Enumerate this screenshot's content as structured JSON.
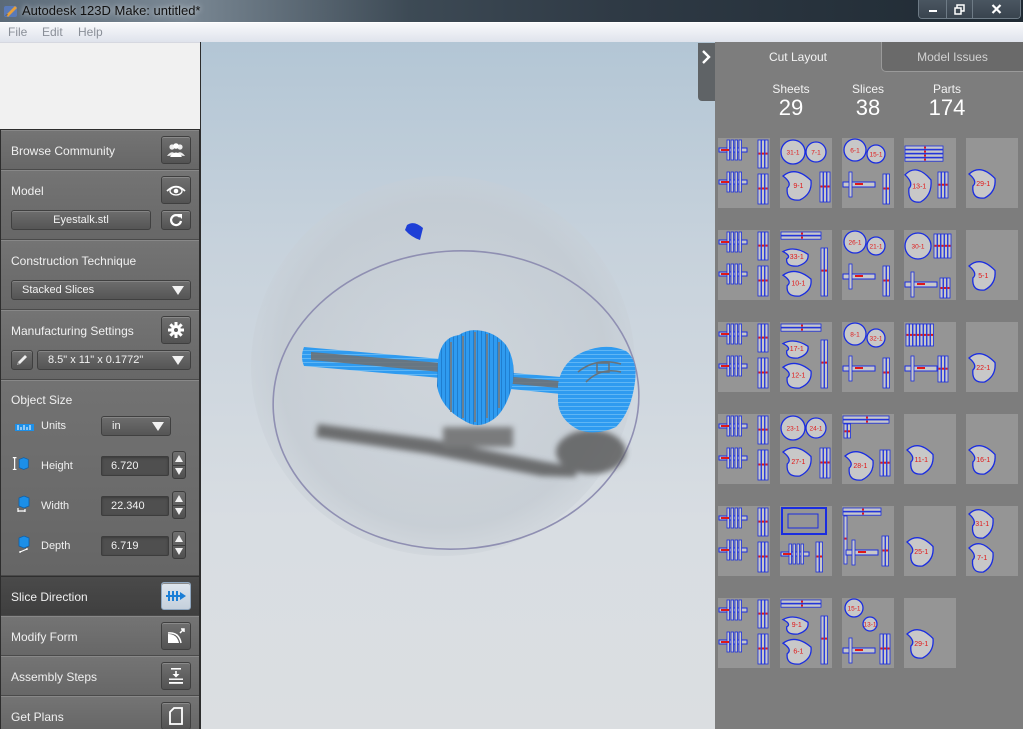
{
  "window": {
    "title": "Autodesk 123D Make: untitled*",
    "controls": {
      "minimize": "minimize",
      "maximize": "restore",
      "close": "close"
    }
  },
  "menu": {
    "items": [
      "File",
      "Edit",
      "Help"
    ]
  },
  "left_panel": {
    "browse_community": {
      "label": "Browse Community",
      "icon": "people-icon"
    },
    "model": {
      "label": "Model",
      "icon": "eye-icon",
      "file_name": "Eyestalk.stl",
      "reload_icon": "refresh-icon"
    },
    "construction_technique": {
      "label": "Construction Technique",
      "selected": "Stacked Slices"
    },
    "manufacturing_settings": {
      "label": "Manufacturing Settings",
      "icon": "gear-icon",
      "edit_icon": "pencil-icon",
      "selected": "8.5\" x 11\" x 0.1772\""
    },
    "object_size": {
      "label": "Object Size",
      "units_label": "Units",
      "units_value": "in",
      "height_label": "Height",
      "height_value": "6.720",
      "width_label": "Width",
      "width_value": "22.340",
      "depth_label": "Depth",
      "depth_value": "6.719"
    },
    "slice_direction": {
      "label": "Slice Direction",
      "icon": "slice-direction-icon"
    },
    "modify_form": {
      "label": "Modify Form",
      "icon": "modify-form-icon"
    },
    "assembly_steps": {
      "label": "Assembly Steps",
      "icon": "assembly-steps-icon"
    },
    "get_plans": {
      "label": "Get Plans",
      "icon": "document-icon"
    }
  },
  "viewport": {
    "model_name": "Eyestalk",
    "model_color": "#2f9bf0",
    "marker_color": "#1e3fd6"
  },
  "right_panel": {
    "collapse_icon": "chevron-right-icon",
    "tabs": [
      {
        "label": "Cut Layout",
        "active": true
      },
      {
        "label": "Model Issues",
        "active": false
      }
    ],
    "stats": {
      "sheets_label": "Sheets",
      "sheets_value": "29",
      "slices_label": "Slices",
      "slices_value": "38",
      "parts_label": "Parts",
      "parts_value": "174"
    },
    "sheet_rows": [
      [
        "sheet-combs",
        "sheet-discs",
        "sheet-discs-comb",
        "sheet-rails-disc",
        "sheet-single-disc"
      ],
      [
        "sheet-combs",
        "sheet-bar-discs",
        "sheet-discs-comb",
        "sheet-disc-rails",
        "sheet-single-disc"
      ],
      [
        "sheet-combs",
        "sheet-bar-discs",
        "sheet-discs-comb",
        "sheet-rails",
        "sheet-single-disc"
      ],
      [
        "sheet-combs",
        "sheet-discs",
        "sheet-bar-disc",
        "sheet-single-disc",
        "sheet-single-disc"
      ],
      [
        "sheet-combs",
        "sheet-frames",
        "sheet-frame-comb",
        "sheet-single-disc",
        "sheet-double-disc"
      ],
      [
        "sheet-combs",
        "sheet-bar-discs",
        "sheet-small-discs-comb",
        "sheet-single-disc"
      ]
    ],
    "part_labels": [
      "31-1",
      "7-1",
      "9-1",
      "6-1",
      "15-1",
      "13-1",
      "29-1",
      "33-1",
      "10-1",
      "26-1",
      "21-1",
      "30-1",
      "5-1",
      "17-1",
      "12-1",
      "8-1",
      "32-1",
      "22-1",
      "23-1",
      "24-1",
      "27-1",
      "28-1",
      "11-1",
      "16-1",
      "25-1"
    ],
    "colors": {
      "outline": "#1a2de0",
      "label": "#e01818",
      "part_fill": "#c8c8c8",
      "sheet": "#959595"
    }
  }
}
